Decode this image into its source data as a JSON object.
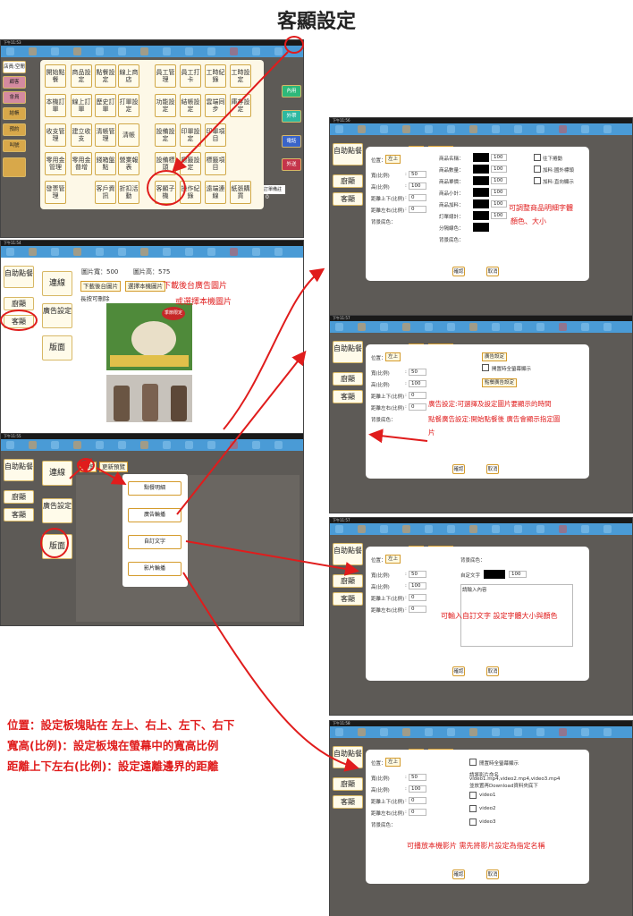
{
  "page_title": "客顯設定",
  "shot1": {
    "time": "下午11:53",
    "left_buttons": [
      "店員:空閒",
      "顧客",
      "會員",
      "結帳",
      "預約",
      "叫號"
    ],
    "menu": [
      [
        "開始點餐",
        "商品設定",
        "點餐設定",
        "線上商店",
        "員工管理",
        "員工打卡",
        "工時紀錄",
        "工時設定"
      ],
      [
        "本機訂單",
        "線上訂單",
        "歷史訂單",
        "打單設定",
        "功能設定",
        "結帳設定",
        "雲端同步",
        "庫存設定"
      ],
      [
        "收支管理",
        "建立收支",
        "清帳管理",
        "清帳",
        "設備設定",
        "印單設定",
        "印單項目"
      ],
      [
        "零用金管理",
        "零用金普增",
        "錢箱盤點",
        "營業報表",
        "設備標頭",
        "標籤設定",
        "標籤項目"
      ],
      [
        "發票管理",
        "",
        "客戶資訊",
        "折扣活動",
        "客顯子機",
        "操作紀錄",
        "遠端連線",
        "紙張購買"
      ]
    ],
    "right_labels": [
      "內用",
      "外帶",
      "電話",
      "外送"
    ],
    "extra_text": "訂單備註",
    "extra_value": "0"
  },
  "shot2": {
    "time": "下午11:54",
    "left_nav": [
      "自助點餐",
      "廚顯",
      "客顯"
    ],
    "mid_nav": [
      "連線",
      "廣告設定",
      "版面"
    ],
    "img_width_label": "圖片寬：500",
    "img_height_label": "圖片高：575",
    "btn_download": "下載後台圖片",
    "btn_select": "選擇本機圖片",
    "longpress": "長按可刪除",
    "note1": "下載後台廣告圖片",
    "note2": "或選擇本機圖片",
    "ad_text": "季節限定"
  },
  "shot3": {
    "time": "下午11:55",
    "left_nav": [
      "自助點餐",
      "廚顯",
      "客顯"
    ],
    "mid_nav": [
      "連線",
      "廣告設定",
      "版面"
    ],
    "btn_new": "新增",
    "btn_update": "更新預覽",
    "popup": [
      "點餐明細",
      "廣告輪播",
      "自訂文字",
      "影片輪播"
    ]
  },
  "dialog_common": {
    "pos_label": "位置：",
    "pos_value": "左上",
    "w_label": "寬(比例)",
    "h_label": "高(比例)",
    "tb_label": "距離上下(比例)",
    "lr_label": "距離左右(比例)",
    "bg_label": "背景底色：",
    "ok": "確認",
    "cancel": "取消",
    "new_btn": "新增",
    "update_btn": "更新預覽",
    "left_nav": [
      "自助點餐",
      "廚顯",
      "客顯"
    ]
  },
  "d1": {
    "time": "下午11:56",
    "w": "50",
    "h": "100",
    "tb": "0",
    "lr": "0",
    "fields": [
      "商品名稱：",
      "商品數量：",
      "商品單價：",
      "商品小計：",
      "商品加料：",
      "訂單總計：",
      "分隔線色：",
      "背景底色："
    ],
    "values": [
      "100",
      "100",
      "100",
      "100",
      "100",
      "100"
    ],
    "checks": [
      "往下捲動",
      "加料:國外標頭",
      "加料:直向顯示"
    ],
    "note": "可調整商品明細字體",
    "note2": "顏色、大小"
  },
  "d2": {
    "time": "下午11:57",
    "w": "50",
    "h": "100",
    "tb": "0",
    "lr": "0",
    "btn_ad": "廣告設定",
    "check": "開置時全螢幕顯示",
    "btn_point": "點餐廣告設定",
    "note1": "廣告設定:可選擇及設定圖片要顯示的時間",
    "note2": "點餐廣告設定:開始點餐後 廣告會顯示指定圖",
    "note3": "片"
  },
  "d3": {
    "time": "下午11:57",
    "w": "50",
    "h": "100",
    "tb": "0",
    "lr": "0",
    "bg_label": "背景底色：",
    "custom_text": "自定文字",
    "size": "100",
    "placeholder": "請輸入內容",
    "note": "可輸入自訂文字 設定字體大小與顏色"
  },
  "d4": {
    "time": "下午11:58",
    "w": "50",
    "h": "100",
    "tb": "0",
    "lr": "0",
    "check_full": "閒置時全螢幕顯示",
    "desc1": "請將影片命名",
    "desc2": "video1.mp4,video2.mp4,video3.mp4",
    "desc3": "並放置再Download資料夾底下",
    "videos": [
      "video1",
      "video2",
      "video3"
    ],
    "note": "可播放本機影片 需先將影片設定為指定名稱"
  },
  "legend": {
    "line1": "位置：設定板塊貼在 左上、右上、左下、右下",
    "line2": "寬高(比例)：設定板塊在螢幕中的寬高比例",
    "line3": "距離上下左右(比例)：設定遠離邊界的距離"
  },
  "colors": {
    "accent_red": "#e01c1c",
    "toolbar_blue": "#4a9bd6",
    "gold": "#d49b2c",
    "bg_gray": "#5d5a56"
  }
}
